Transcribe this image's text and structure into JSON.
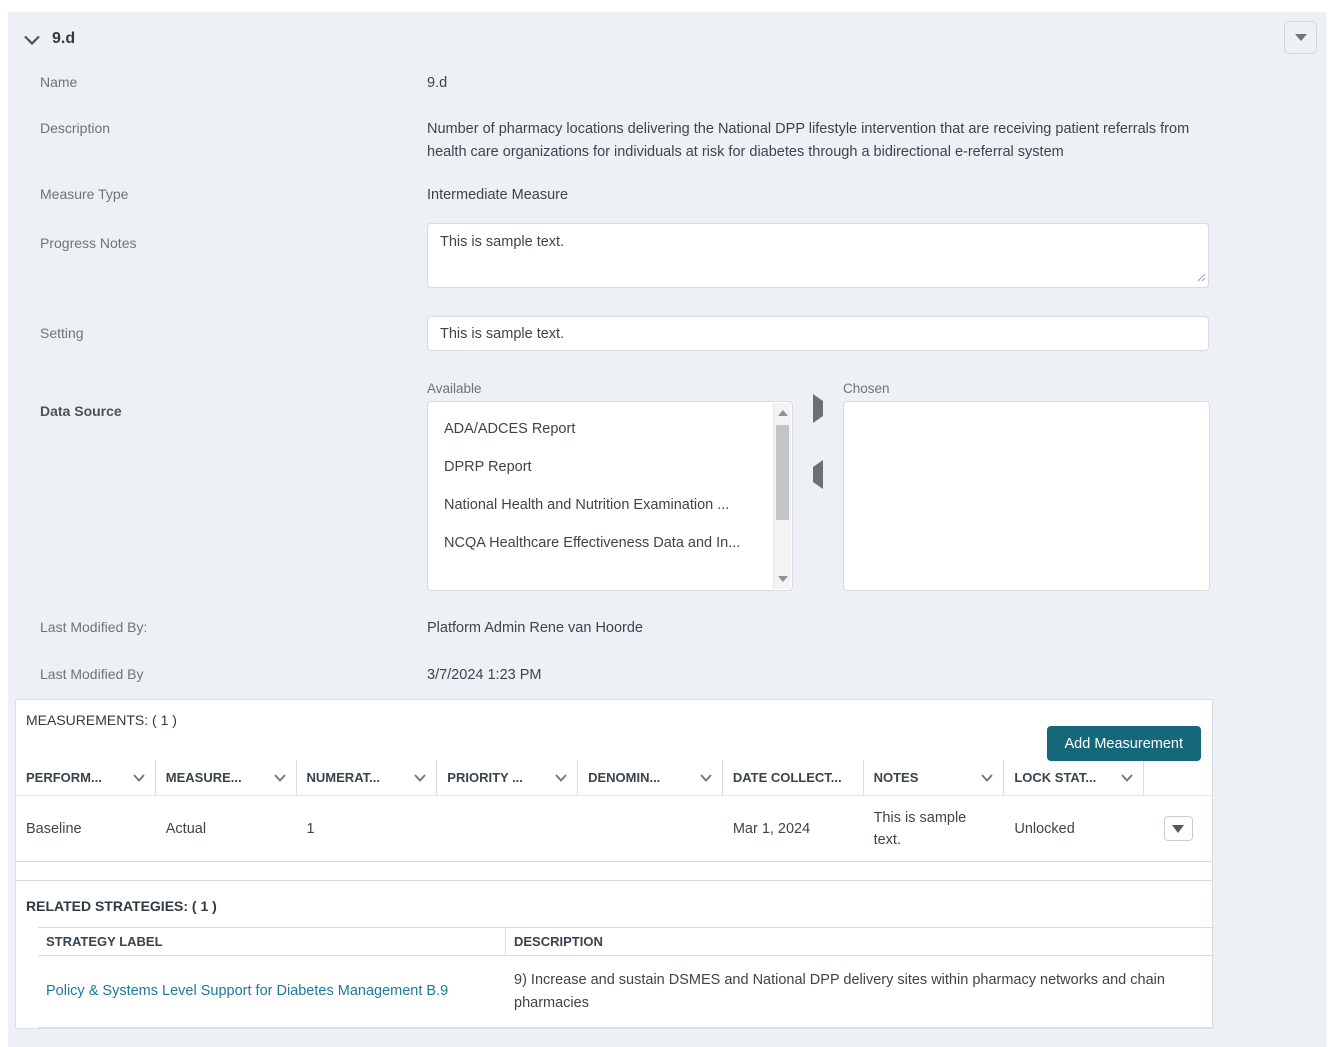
{
  "section": {
    "title": "9.d"
  },
  "form": {
    "name": {
      "label": "Name",
      "value": "9.d"
    },
    "description": {
      "label": "Description",
      "value": "Number of pharmacy locations delivering the National DPP lifestyle intervention that are receiving patient referrals from health care organizations for individuals at risk for diabetes through a bidirectional e-referral system"
    },
    "measure_type": {
      "label": "Measure Type",
      "value": "Intermediate Measure"
    },
    "progress_notes": {
      "label": "Progress Notes",
      "value": "This is sample text."
    },
    "setting": {
      "label": "Setting",
      "value": "This is sample text."
    },
    "data_source": {
      "label": "Data Source",
      "available_label": "Available",
      "chosen_label": "Chosen",
      "available_options": [
        "ADA/ADCES Report",
        "DPRP Report",
        "National Health and Nutrition Examination ...",
        "NCQA Healthcare Effectiveness Data and In..."
      ],
      "chosen_options": []
    },
    "last_modified_by_user": {
      "label": "Last Modified By:",
      "value": "Platform Admin Rene van Hoorde"
    },
    "last_modified_date": {
      "label": "Last Modified By",
      "value": "3/7/2024 1:23 PM"
    }
  },
  "measurements": {
    "title": "MEASUREMENTS: ( 1 )",
    "add_button_label": "Add Measurement",
    "columns": [
      "PERFORM...",
      "MEASURE...",
      "NUMERAT...",
      "PRIORITY ...",
      "DENOMIN...",
      "DATE COLLECT...",
      "NOTES",
      "LOCK STAT..."
    ],
    "rows": [
      [
        "Baseline",
        "Actual",
        "1",
        "",
        "",
        "Mar 1, 2024",
        "This is sample text.",
        "Unlocked"
      ]
    ]
  },
  "related_strategies": {
    "title": "RELATED STRATEGIES: ( 1 )",
    "columns": [
      "STRATEGY LABEL",
      "DESCRIPTION"
    ],
    "rows": [
      {
        "label": "Policy & Systems Level Support for Diabetes Management B.9",
        "description": "9) Increase and sustain DSMES and National DPP delivery sites within pharmacy networks and chain pharmacies"
      }
    ]
  },
  "colors": {
    "accent_button": "#15687a",
    "link": "#1e7898",
    "panel_background": "#edf1f5"
  }
}
